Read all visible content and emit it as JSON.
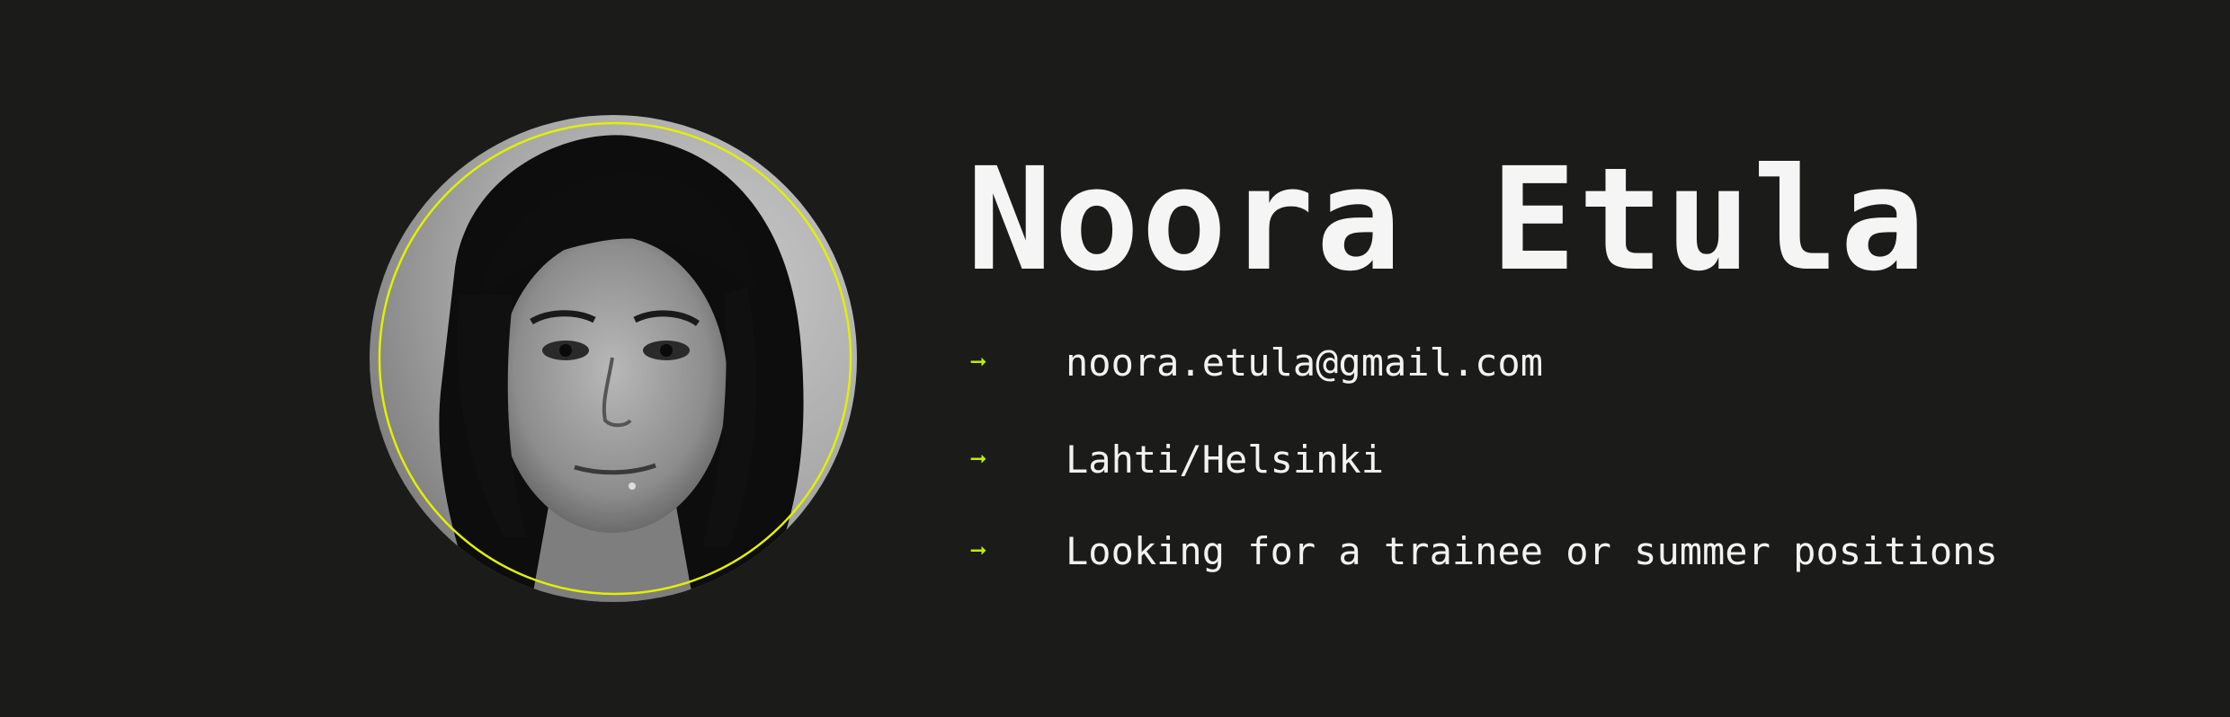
{
  "profile": {
    "name": "Noora Etula",
    "accent_color": "#b8f000",
    "ring_color": "#e2f000",
    "background_color": "#1b1b1a",
    "photo": "portrait photo (grayscale)"
  },
  "details": [
    {
      "icon": "arrow-right-icon",
      "text": "noora.etula@gmail.com"
    },
    {
      "icon": "arrow-right-icon",
      "text": "Lahti/Helsinki"
    },
    {
      "icon": "arrow-right-icon",
      "text": "Looking for a trainee or summer positions"
    }
  ]
}
